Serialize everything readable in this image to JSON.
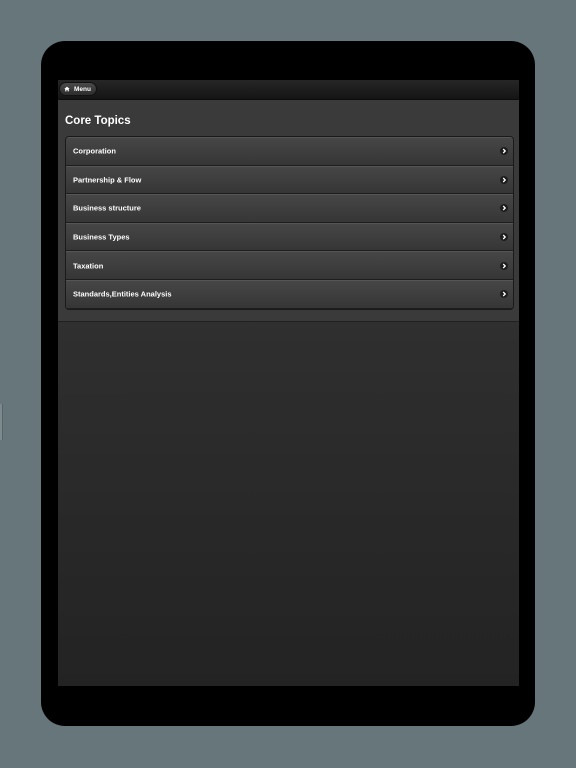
{
  "nav": {
    "menu_label": "Menu",
    "menu_icon": "home-icon"
  },
  "page": {
    "title": "Core Topics"
  },
  "topics": [
    {
      "label": "Corporation"
    },
    {
      "label": "Partnership & Flow"
    },
    {
      "label": "Business structure"
    },
    {
      "label": "Business Types"
    },
    {
      "label": "Taxation"
    },
    {
      "label": "Standards,Entities Analysis"
    }
  ],
  "colors": {
    "background": "#66767a",
    "device_frame": "#000000",
    "battery": "#4ccf5a",
    "text": "#ffffff"
  }
}
